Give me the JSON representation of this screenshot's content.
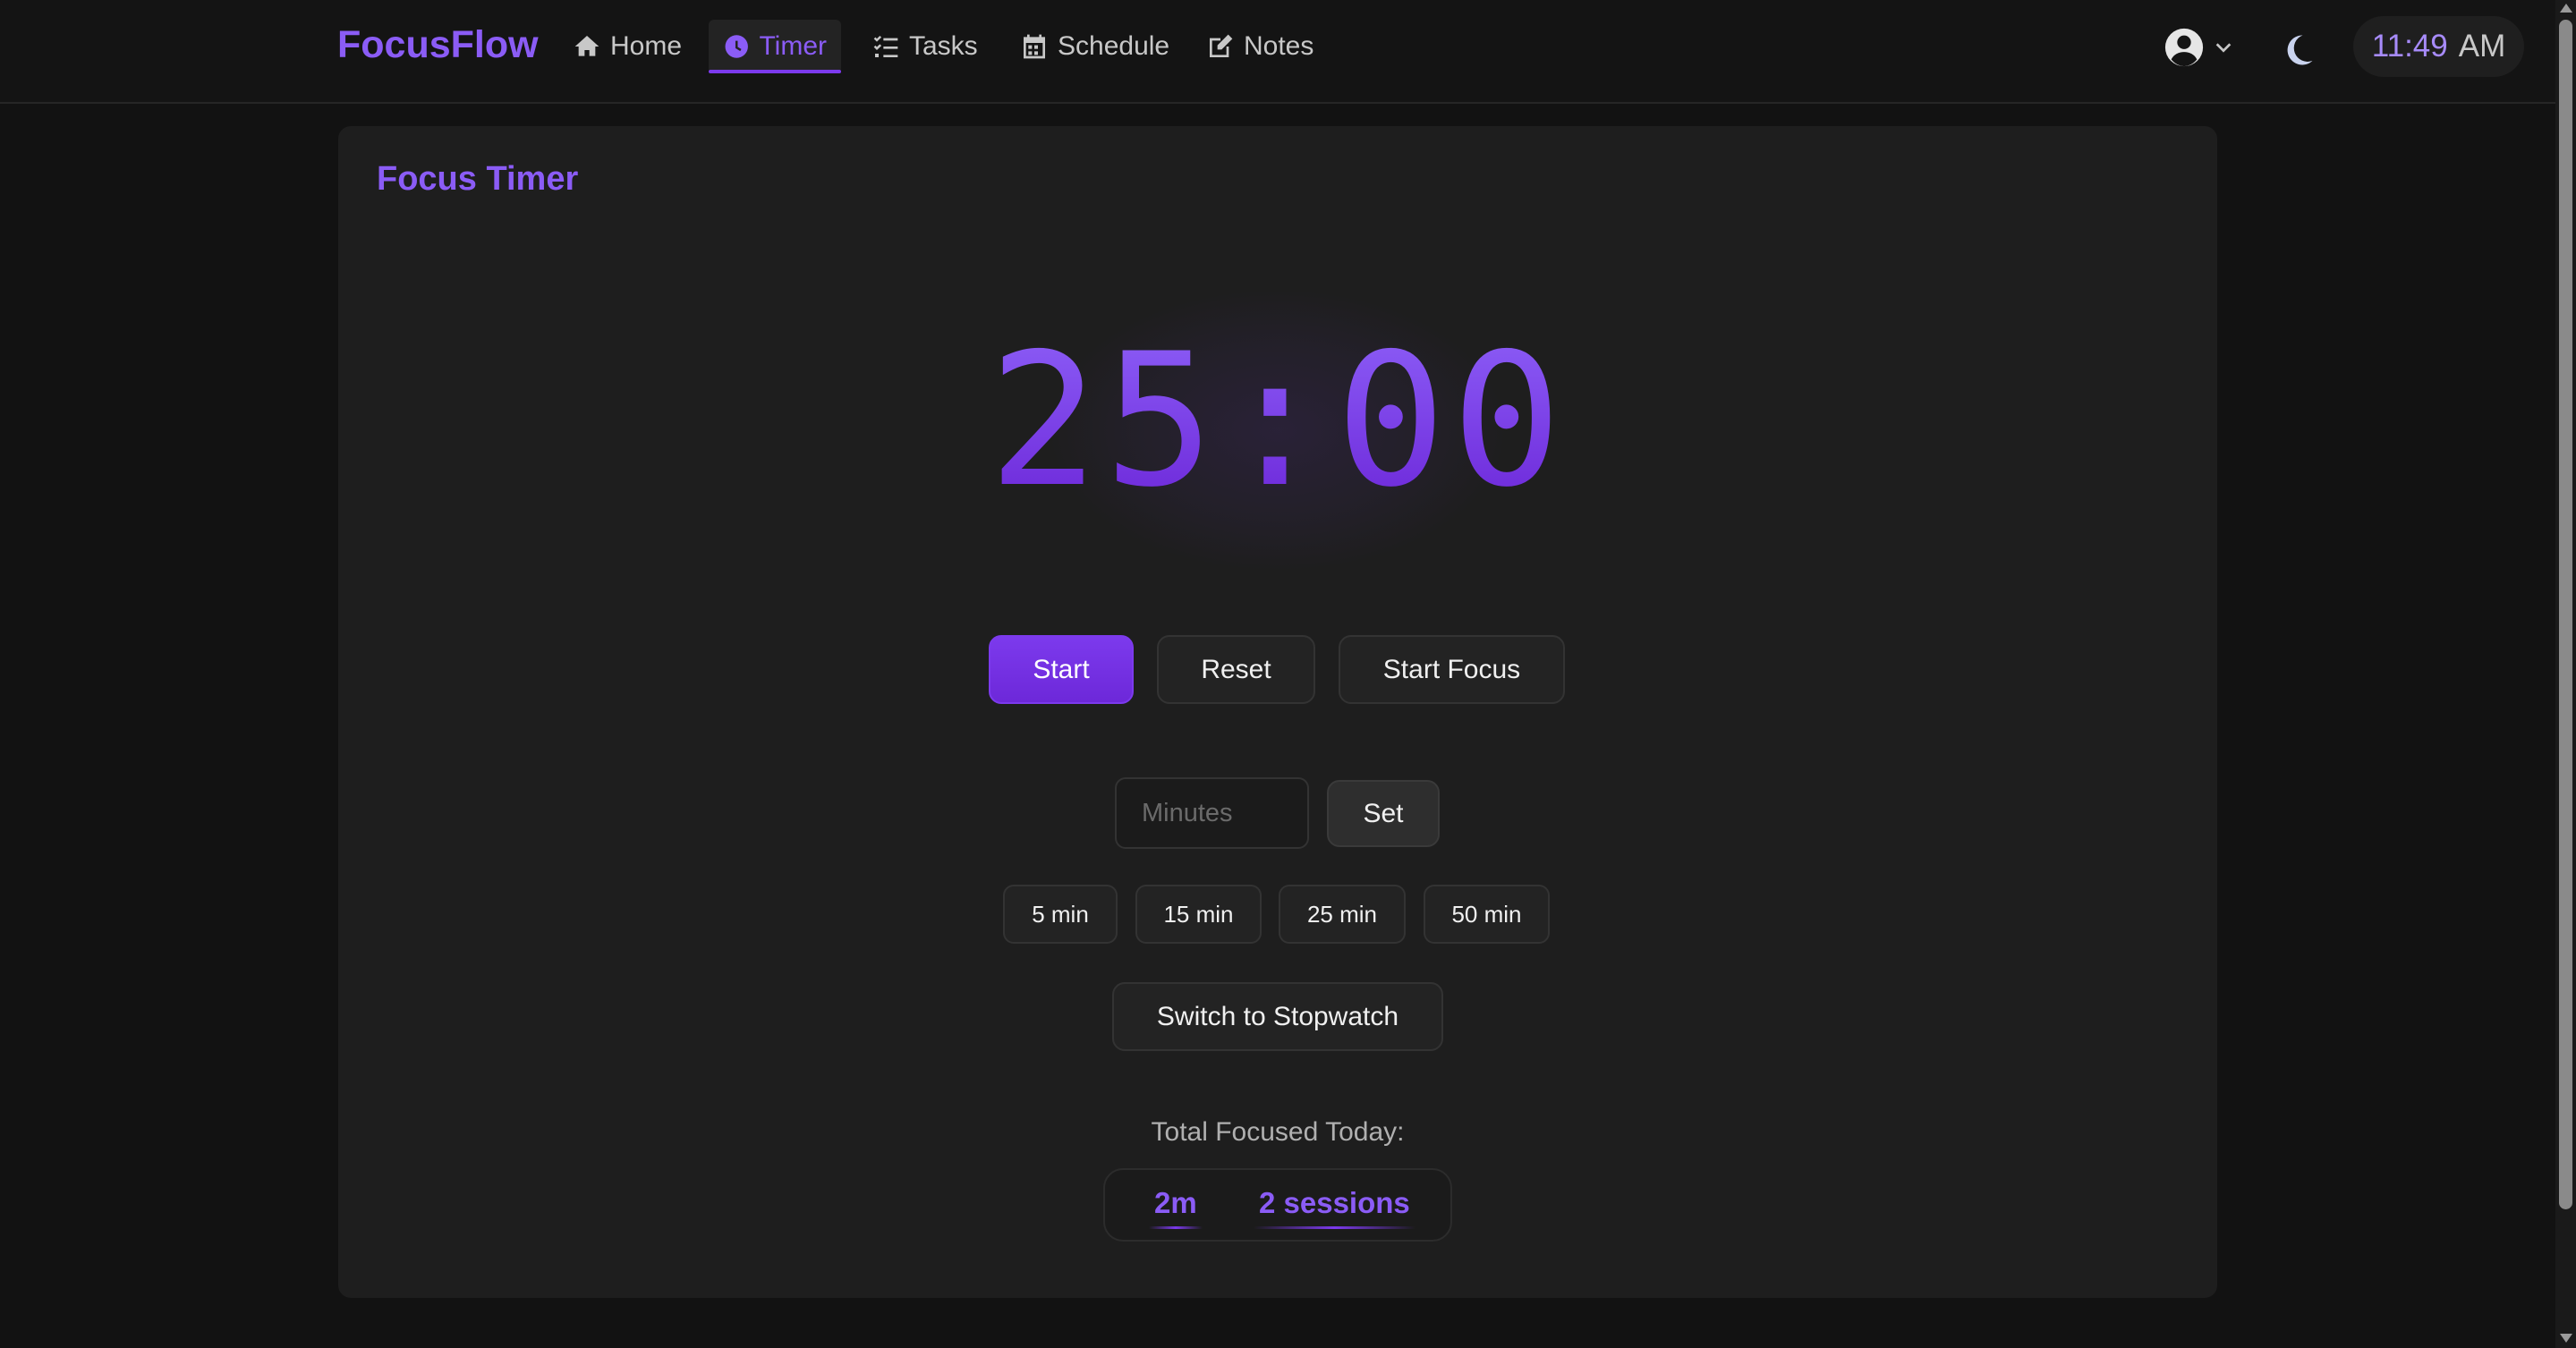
{
  "app": {
    "brand": "FocusFlow"
  },
  "nav": {
    "items": [
      {
        "label": "Home",
        "icon": "home-icon"
      },
      {
        "label": "Timer",
        "icon": "clock-icon",
        "active": true
      },
      {
        "label": "Tasks",
        "icon": "list-check-icon"
      },
      {
        "label": "Schedule",
        "icon": "calendar-icon"
      },
      {
        "label": "Notes",
        "icon": "edit-icon"
      }
    ],
    "user_icon": "user-circle-icon",
    "theme_icon": "moon-icon",
    "clock": {
      "time": "11:49",
      "ampm": "AM"
    }
  },
  "timer": {
    "title": "Focus Timer",
    "display": "25:00",
    "buttons": {
      "start": "Start",
      "reset": "Reset",
      "start_focus": "Start Focus"
    },
    "custom": {
      "placeholder": "Minutes",
      "set_label": "Set"
    },
    "presets": [
      "5 min",
      "15 min",
      "25 min",
      "50 min"
    ],
    "switch_label": "Switch to Stopwatch",
    "total_label": "Total Focused Today:",
    "total_time": "2m",
    "total_sessions": "2 sessions"
  },
  "colors": {
    "accent": "#8b5cf6",
    "accent_dark": "#6d28d9",
    "background": "#121212",
    "card": "#1e1e1e"
  }
}
